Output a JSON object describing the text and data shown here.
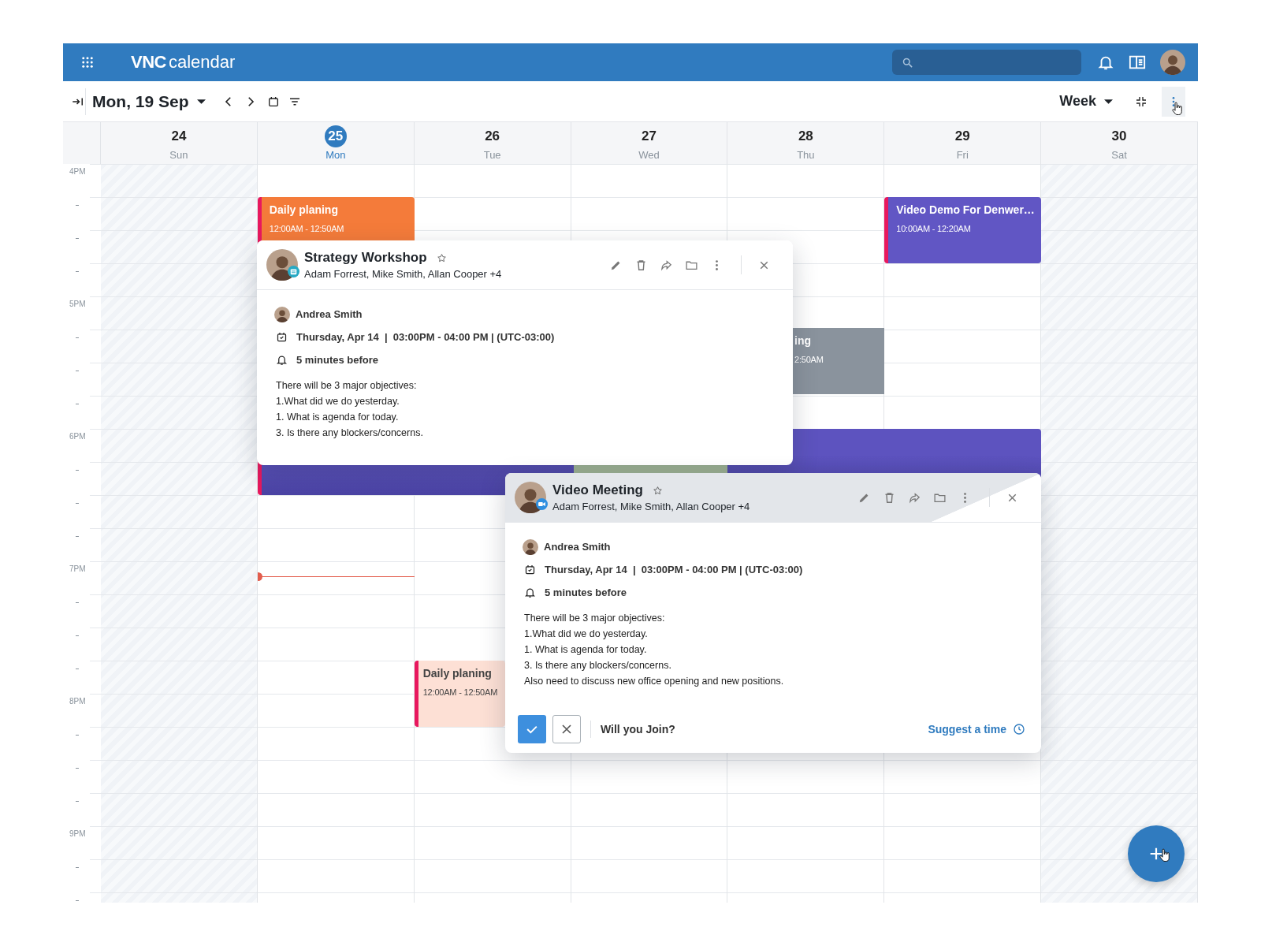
{
  "header": {
    "logo": {
      "bold": "VNC",
      "light": "calendar"
    }
  },
  "toolbar": {
    "date": "Mon, 19 Sep",
    "view": "Week"
  },
  "days": [
    {
      "number": "24",
      "weekday": "Sun",
      "selected": false,
      "weekend": true
    },
    {
      "number": "25",
      "weekday": "Mon",
      "selected": true,
      "weekend": false
    },
    {
      "number": "26",
      "weekday": "Tue",
      "selected": false,
      "weekend": false
    },
    {
      "number": "27",
      "weekday": "Wed",
      "selected": false,
      "weekend": false
    },
    {
      "number": "28",
      "weekday": "Thu",
      "selected": false,
      "weekend": false
    },
    {
      "number": "29",
      "weekday": "Fri",
      "selected": false,
      "weekend": false
    },
    {
      "number": "30",
      "weekday": "Sat",
      "selected": false,
      "weekend": true
    }
  ],
  "time_labels": [
    "4PM",
    "5PM",
    "6PM",
    "7PM",
    "8PM",
    "9PM"
  ],
  "events": [
    {
      "kind": "solid",
      "title": "Daily planing",
      "time": "12:00AM - 12:50AM",
      "color": "#f47b3a"
    },
    {
      "kind": "solid",
      "title": "Video Demo For Denwer…",
      "time": "10:00AM - 12:20AM",
      "color": "#6156c4"
    },
    {
      "kind": "solid",
      "title": "ing",
      "time": "2:50AM",
      "color": "#8a939d"
    },
    {
      "kind": "solid",
      "color": "#5d53bf"
    },
    {
      "kind": "solid"
    },
    {
      "kind": "pale",
      "title": "Daily planing",
      "time": "12:00AM - 12:50AM",
      "color": "#fde0d5"
    }
  ],
  "popups": [
    {
      "kind": "calendar",
      "focused": false,
      "title": "Strategy Workshop",
      "attendees": "Adam Forrest, Mike Smith, Allan Cooper +4",
      "organizer": "Andrea Smith",
      "when": "Thursday, Apr 14  |  03:00PM - 04:00 PM | (UTC-03:00)",
      "reminder": "5 minutes before",
      "description": [
        "There will be 3 major objectives:",
        "1.What did we do yesterday.",
        "1. What is agenda for today.",
        "3. Is there any blockers/concerns."
      ]
    },
    {
      "kind": "video",
      "focused": true,
      "title": "Video Meeting",
      "attendees": "Adam Forrest, Mike Smith, Allan Cooper +4",
      "organizer": "Andrea Smith",
      "when": "Thursday, Apr 14  |  03:00PM - 04:00 PM | (UTC-03:00)",
      "reminder": "5 minutes before",
      "description": [
        "There will be 3 major objectives:",
        "1.What did we do yesterday.",
        "1. What is agenda for today.",
        "3. Is there any blockers/concerns.",
        "Also need to discuss new office opening and new positions."
      ],
      "rsvp": {
        "question": "Will you Join?",
        "suggest": "Suggest a time"
      }
    }
  ]
}
